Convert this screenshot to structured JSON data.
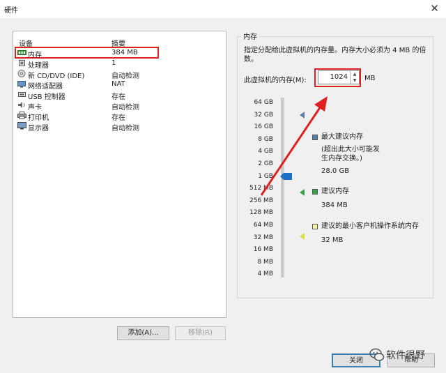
{
  "window": {
    "title": "硬件",
    "close": "✕"
  },
  "devices": {
    "col_device": "设备",
    "col_summary": "摘要",
    "items": [
      {
        "name": "内存",
        "summary": "384 MB",
        "icon": "memory-icon"
      },
      {
        "name": "处理器",
        "summary": "1",
        "icon": "cpu-icon"
      },
      {
        "name": "新 CD/DVD (IDE)",
        "summary": "自动检测",
        "icon": "cd-icon"
      },
      {
        "name": "网络适配器",
        "summary": "NAT",
        "icon": "network-icon"
      },
      {
        "name": "USB 控制器",
        "summary": "存在",
        "icon": "usb-icon"
      },
      {
        "name": "声卡",
        "summary": "自动检测",
        "icon": "sound-icon"
      },
      {
        "name": "打印机",
        "summary": "存在",
        "icon": "printer-icon"
      },
      {
        "name": "显示器",
        "summary": "自动检测",
        "icon": "display-icon"
      }
    ]
  },
  "buttons": {
    "add": "添加(A)...",
    "remove": "移除(R)",
    "ok": "关闭",
    "help": "帮助"
  },
  "memory": {
    "group_title": "内存",
    "description": "指定分配给此虚拟机的内存量。内存大小必须为 4 MB 的倍数。",
    "label": "此虚拟机的内存(M):",
    "value": "1024",
    "unit": "MB",
    "ticks": [
      "64 GB",
      "32 GB",
      "16 GB",
      "8 GB",
      "4 GB",
      "2 GB",
      "1 GB",
      "512 MB",
      "256 MB",
      "128 MB",
      "64 MB",
      "32 MB",
      "16 MB",
      "8 MB",
      "4 MB"
    ],
    "legend": {
      "max_title": "最大建议内存",
      "max_note": "(超出此大小可能发生内存交换。)",
      "max_value": "28.0 GB",
      "rec_title": "建议内存",
      "rec_value": "384 MB",
      "min_title": "建议的最小客户机操作系统内存",
      "min_value": "32 MB"
    },
    "colors": {
      "max": "#5a7fa8",
      "rec": "#3aa34a",
      "min": "#d4e34a",
      "thumb": "#1e6fc8",
      "highlight": "#e02020"
    }
  },
  "watermark": {
    "text": "软件很野"
  }
}
